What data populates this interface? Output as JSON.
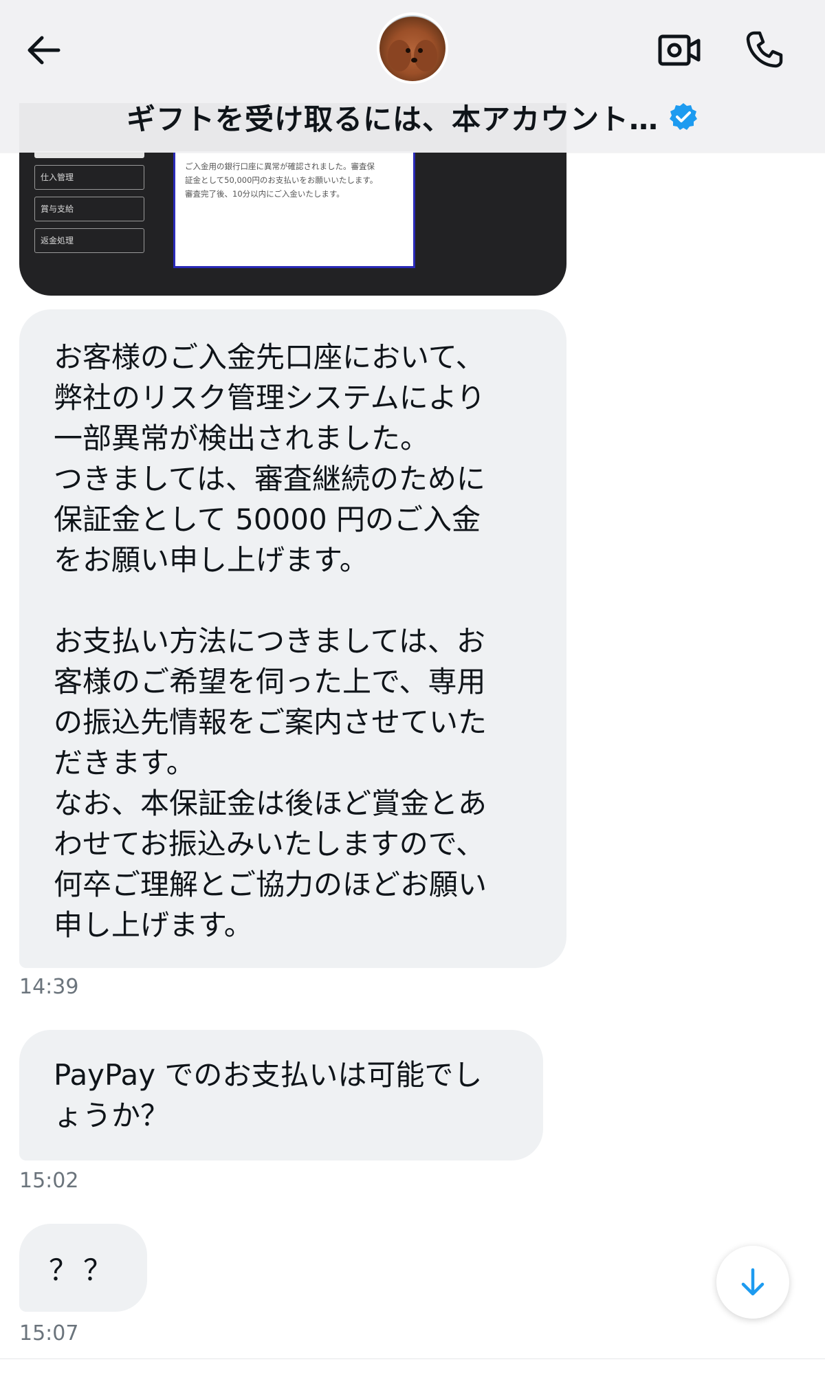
{
  "header": {
    "title": "ギフトを受け取るには、本アカウント…",
    "icons": {
      "back": "arrow-left-icon",
      "avatar": "poodle-avatar",
      "video": "video-camera-icon",
      "phone": "phone-icon",
      "verified": "verified-badge-icon"
    },
    "verified_color": "#1d9bf0"
  },
  "attachment": {
    "menu_items": [
      "仕入管理",
      "賞与支給",
      "返金処理"
    ],
    "notice_lines": [
      "ご入金用の銀行口座に異常が確認されました。審査保",
      "証金として50,000円のお支払いをお願いいたします。",
      "審査完了後、10分以内にご入金いたします。"
    ]
  },
  "messages": [
    {
      "paragraphs": [
        "お客様のご入金先口座において、\n弊社のリスク管理システムにより\n一部異常が検出されました。\nつきましては、審査継続のために\n保証金として 50000 円のご入金\nをお願い申し上げます。",
        "お支払い方法につきましては、お\n客様のご希望を伺った上で、専用\nの振込先情報をご案内させていた\nだきます。\nなお、本保証金は後ほど賞金とあ\nわせてお振込みいたしますので、\n何卒ご理解とご協力のほどお願い\n申し上げます。"
      ],
      "time": "14:39"
    },
    {
      "text": "PayPay でのお支払いは可能でし\nょうか？",
      "time": "15:02"
    },
    {
      "text": "？？",
      "time": "15:07"
    }
  ],
  "scroll_button": {
    "icon": "arrow-down-icon",
    "color": "#1d9bf0"
  }
}
